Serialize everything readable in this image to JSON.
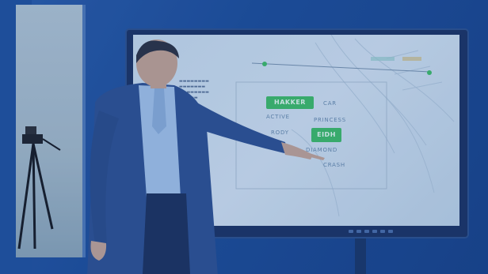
{
  "screen": {
    "words": [
      "CAR",
      "PRINCESS",
      "CRASH",
      "DIAMOND",
      "ACTIVE",
      "RODY"
    ],
    "highlighted": [
      "HAKKER",
      "EIDH"
    ]
  }
}
